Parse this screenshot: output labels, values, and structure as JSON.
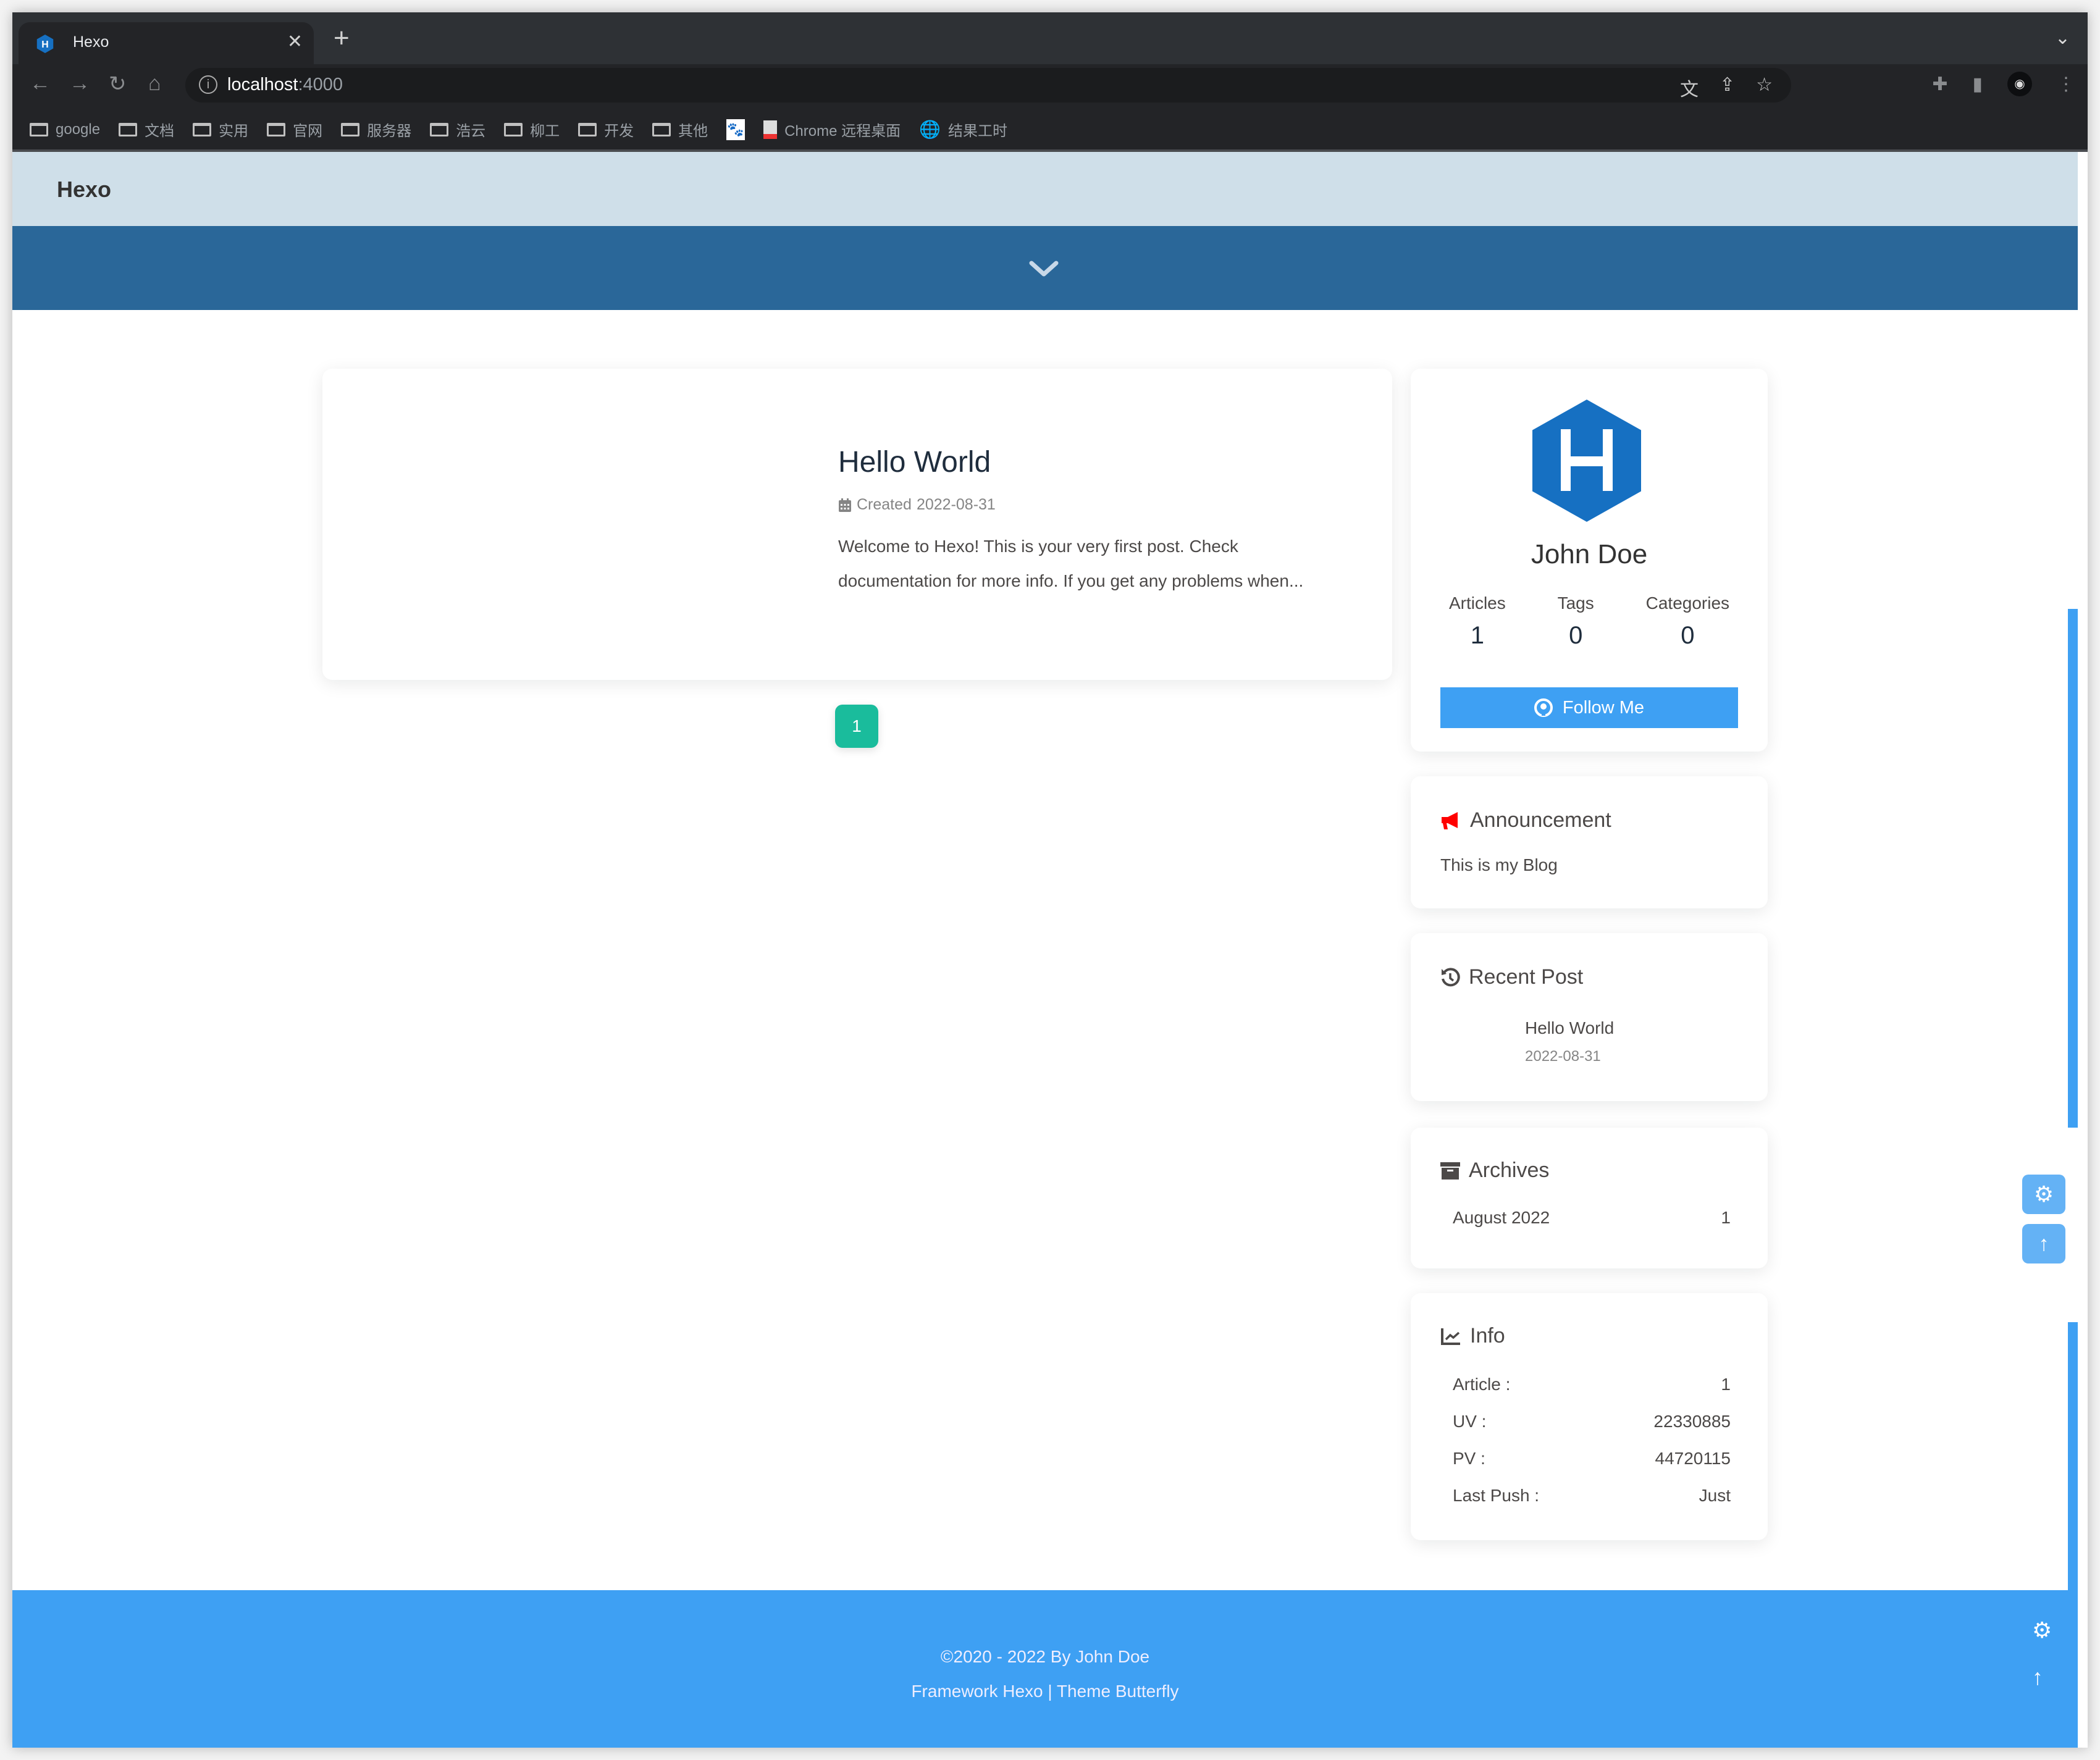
{
  "browser": {
    "tab_title": "Hexo",
    "url_host": "localhost",
    "url_port": ":4000",
    "bookmarks": [
      "google",
      "文档",
      "实用",
      "官网",
      "服务器",
      "浩云",
      "柳工",
      "开发",
      "其他"
    ],
    "bookmark_extra": [
      "Chrome 远程桌面",
      "结果工时"
    ]
  },
  "site": {
    "name": "Hexo"
  },
  "post": {
    "title": "Hello World",
    "meta_label": "Created",
    "date": "2022-08-31",
    "excerpt": "Welcome to Hexo! This is your very first post. Check documentation for more info. If you get any problems when..."
  },
  "pagination": {
    "current": "1"
  },
  "author": {
    "name": "John Doe",
    "stats": [
      {
        "label": "Articles",
        "value": "1"
      },
      {
        "label": "Tags",
        "value": "0"
      },
      {
        "label": "Categories",
        "value": "0"
      }
    ],
    "follow_label": "Follow Me"
  },
  "announcement": {
    "title": "Announcement",
    "text": "This is my Blog",
    "icon_color": "#ff0000"
  },
  "recent": {
    "title": "Recent Post",
    "items": [
      {
        "title": "Hello World",
        "date": "2022-08-31"
      }
    ]
  },
  "archives": {
    "title": "Archives",
    "items": [
      {
        "label": "August 2022",
        "count": "1"
      }
    ]
  },
  "info": {
    "title": "Info",
    "rows": [
      {
        "label": "Article :",
        "value": "1"
      },
      {
        "label": "UV :",
        "value": "22330885"
      },
      {
        "label": "PV :",
        "value": "44720115"
      },
      {
        "label": "Last Push :",
        "value": "Just"
      }
    ]
  },
  "footer": {
    "copyright": "©2020 - 2022 By John Doe",
    "framework": "Framework Hexo | Theme Butterfly"
  },
  "colors": {
    "nav_bg": "#cfdfe9",
    "banner_bg": "#2a6799",
    "accent": "#3ea0f3",
    "pager": "#1abc9c",
    "hexo_blue": "#1670c2"
  }
}
